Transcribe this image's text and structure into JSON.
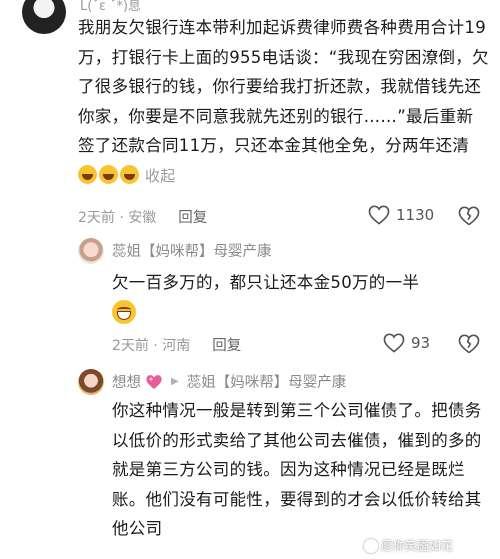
{
  "comments": [
    {
      "username": "L(ˇε ˇ*)息",
      "text": "我朋友欠银行连本带利加起诉费律师费各种费用合计19万，打银行卡上面的955电话谈：“我现在穷困潦倒，欠了很多银行的钱，你行要给我打折还款，我就借钱先还你家，你要是不同意我就先还别的银行……”最后重新签了还款合同11万，只还本金其他全免，分两年还清",
      "emojis": [
        "laugh-cry",
        "laugh-cry",
        "laugh-cry"
      ],
      "fold_label": "收起",
      "time_location": "2天前 · 安徽",
      "reply_label": "回复",
      "likes": "1130"
    }
  ],
  "replies": [
    {
      "username": "蕊姐【妈咪帮】母婴产康",
      "text": "欠一百多万的，都只让还本金50万的一半",
      "emoji": "grin",
      "time_location": "2天前 · 河南",
      "reply_label": "回复",
      "likes": "93"
    },
    {
      "username": "想想",
      "reply_to": "蕊姐【妈咪帮】母婴产康",
      "text": "你这种情况一般是转到第三个公司催债了。把债务以低价的形式卖给了其他公司去催债，催到的多的就是第三方公司的钱。因为这种情况已经是既烂账。他们没有可能性，要得到的才会以低价转给其他公司"
    }
  ],
  "watermark": "愿你笑靥如花",
  "colors": {
    "text": "#1b1b1b",
    "meta": "#9a9a9a",
    "emoji": "#f8c531",
    "heart": "#e85d9a"
  }
}
